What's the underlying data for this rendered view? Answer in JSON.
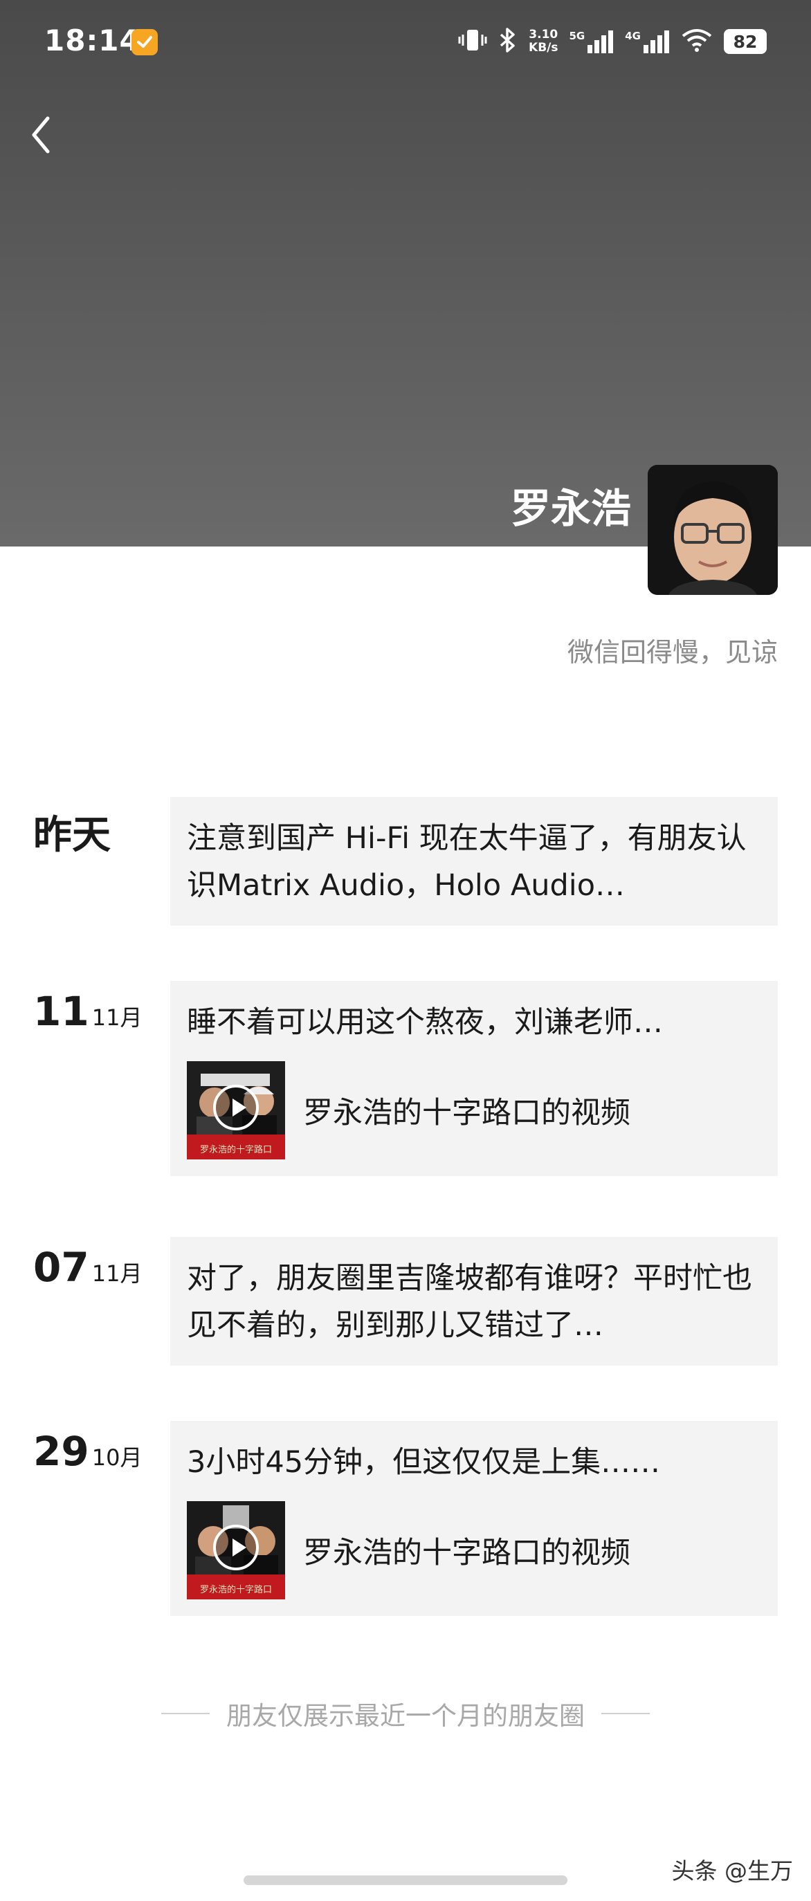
{
  "status_bar": {
    "time": "18:14",
    "app_icon": "notification-app-icon",
    "speed_value": "3.10",
    "speed_unit": "KB/s",
    "network_5g": "5G",
    "network_4g": "4G",
    "battery": "82"
  },
  "header": {
    "back_icon": "back-arrow-icon"
  },
  "profile": {
    "name": "罗永浩",
    "signature": "微信回得慢，见谅"
  },
  "posts": [
    {
      "date_label": "昨天",
      "text": "注意到国产 Hi-Fi 现在太牛逼了，有朋友认识Matrix Audio，Holo Audio…"
    },
    {
      "day": "11",
      "month": "11月",
      "text": "睡不着可以用这个熬夜，刘谦老师…",
      "video_title": "罗永浩的十字路口的视频",
      "thumb_caption": "罗永浩的十字路口"
    },
    {
      "day": "07",
      "month": "11月",
      "text": "对了，朋友圈里吉隆坡都有谁呀？平时忙也见不着的，别到那儿又错过了…"
    },
    {
      "day": "29",
      "month": "10月",
      "text": "3小时45分钟，但这仅仅是上集……",
      "video_title": "罗永浩的十字路口的视频",
      "thumb_caption": "罗永浩的十字路口"
    }
  ],
  "footer": {
    "note": "朋友仅展示最近一个月的朋友圈"
  },
  "watermark": "头条 @生万",
  "colors": {
    "cover_bg": "#555555",
    "card_bg": "#f3f3f3",
    "muted_text": "#8a8a8a",
    "thumb_red": "#c0191e"
  }
}
